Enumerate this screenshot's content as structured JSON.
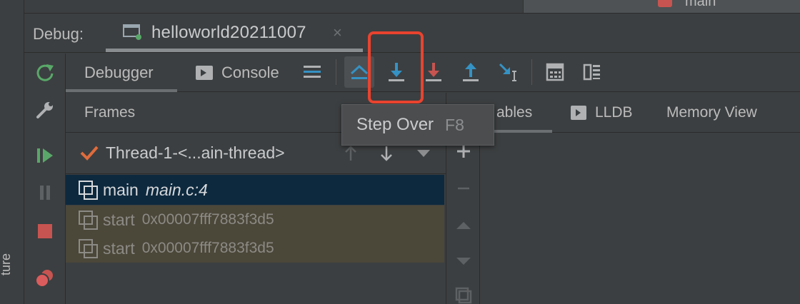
{
  "top": {
    "right_tab_label": "main"
  },
  "debug": {
    "label": "Debug:",
    "session_name": "helloworld20211007",
    "close_glyph": "×"
  },
  "tabs": {
    "debugger": "Debugger",
    "console": "Console"
  },
  "toolbar": {
    "icons": [
      "threads-menu-icon",
      "show-execution-point-icon",
      "step-over-icon",
      "force-step-into-icon",
      "step-out-icon",
      "run-to-cursor-icon",
      "evaluate-expression-icon",
      "trace-icon"
    ]
  },
  "tooltip": {
    "text": "Step Over",
    "shortcut": "F8"
  },
  "frames": {
    "title": "Frames",
    "thread": "Thread-1-<...ain-thread>",
    "items": [
      {
        "func": "main",
        "loc": "main.c:4"
      },
      {
        "func": "start",
        "addr": "0x00007fff7883f3d5"
      },
      {
        "func": "start",
        "addr": "0x00007fff7883f3d5"
      }
    ]
  },
  "right_tabs": {
    "variables_partial": "ables",
    "lldb": "LLDB",
    "memory_view": "Memory View"
  },
  "left_vertical_text": "ture",
  "colors": {
    "highlight": "#e9432f",
    "selected_row": "#0d293e",
    "library_row": "#4b4739",
    "step_blue": "#3592c4",
    "stop_red": "#c75450",
    "resume_green": "#59a869"
  }
}
